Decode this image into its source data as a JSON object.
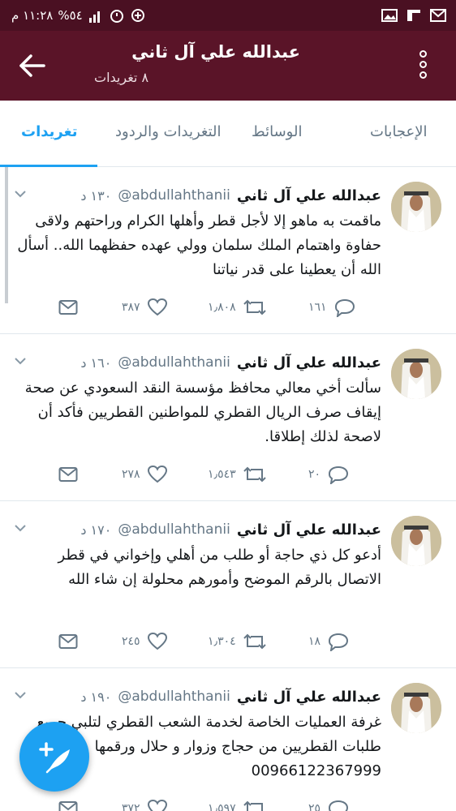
{
  "status_bar": {
    "time": "١١:٢٨ م",
    "battery": "%٥٤"
  },
  "header": {
    "title": "عبدالله علي آل ثاني",
    "subtitle": "٨ تغريدات"
  },
  "tabs": [
    {
      "label": "تغريدات",
      "active": true
    },
    {
      "label": "التغريدات والردود",
      "active": false
    },
    {
      "label": "الوسائط",
      "active": false
    },
    {
      "label": "الإعجابات",
      "active": false
    }
  ],
  "tweets": [
    {
      "name": "عبدالله علي آل ثاني",
      "handle": "@abdullahthanii",
      "time": "١٣٠ د",
      "text": "ماقمت به ماهو إلا لأجل قطر وأهلها الكرام وراحتهم ولاقى حفاوة واهتمام الملك سلمان وولي عهده حفظهما الله.. أسأل الله أن يعطينا على قدر نياتنا",
      "replies": "١٦١",
      "retweets": "١٫٨٠٨",
      "likes": "٣٨٧"
    },
    {
      "name": "عبدالله علي آل ثاني",
      "handle": "@abdullahthanii",
      "time": "١٦٠ د",
      "text": "سألت أخي معالي محافظ مؤسسة النقد السعودي عن صحة إيقاف صرف الريال القطري للمواطنين القطريين فأكد أن لاصحة لذلك إطلاقا.",
      "replies": "٢٠",
      "retweets": "١٫٥٤٣",
      "likes": "٢٧٨"
    },
    {
      "name": "عبدالله علي آل ثاني",
      "handle": "@abdullahthanii",
      "time": "١٧٠ د",
      "text": "أدعو كل ذي حاجة أو طلب من أهلي وإخواني في قطر الاتصال بالرقم الموضح وأمورهم محلولة إن شاء الله",
      "replies": "١٨",
      "retweets": "١٫٣٠٤",
      "likes": "٢٤٥"
    },
    {
      "name": "عبدالله علي آل ثاني",
      "handle": "@abdullahthanii",
      "time": "١٩٠ د",
      "text": "غرفة العمليات الخاصة لخدمة الشعب القطري لتلبي جميع طلبات القطريين من حجاج وزوار و حلال ورقمها 00966122367999",
      "replies": "٢٥",
      "retweets": "١٫٥٩٧",
      "likes": "٣٧٢"
    }
  ],
  "colors": {
    "status_bar": "#4a1022",
    "app_bar": "#5a1428",
    "accent": "#1da1f2",
    "text": "#14171a",
    "muted": "#657786"
  },
  "icons": {
    "back": "back-arrow-icon",
    "overflow": "overflow-menu-icon",
    "reply": "reply-icon",
    "retweet": "retweet-icon",
    "like": "heart-icon",
    "dm": "mail-icon",
    "compose": "compose-tweet-icon"
  }
}
